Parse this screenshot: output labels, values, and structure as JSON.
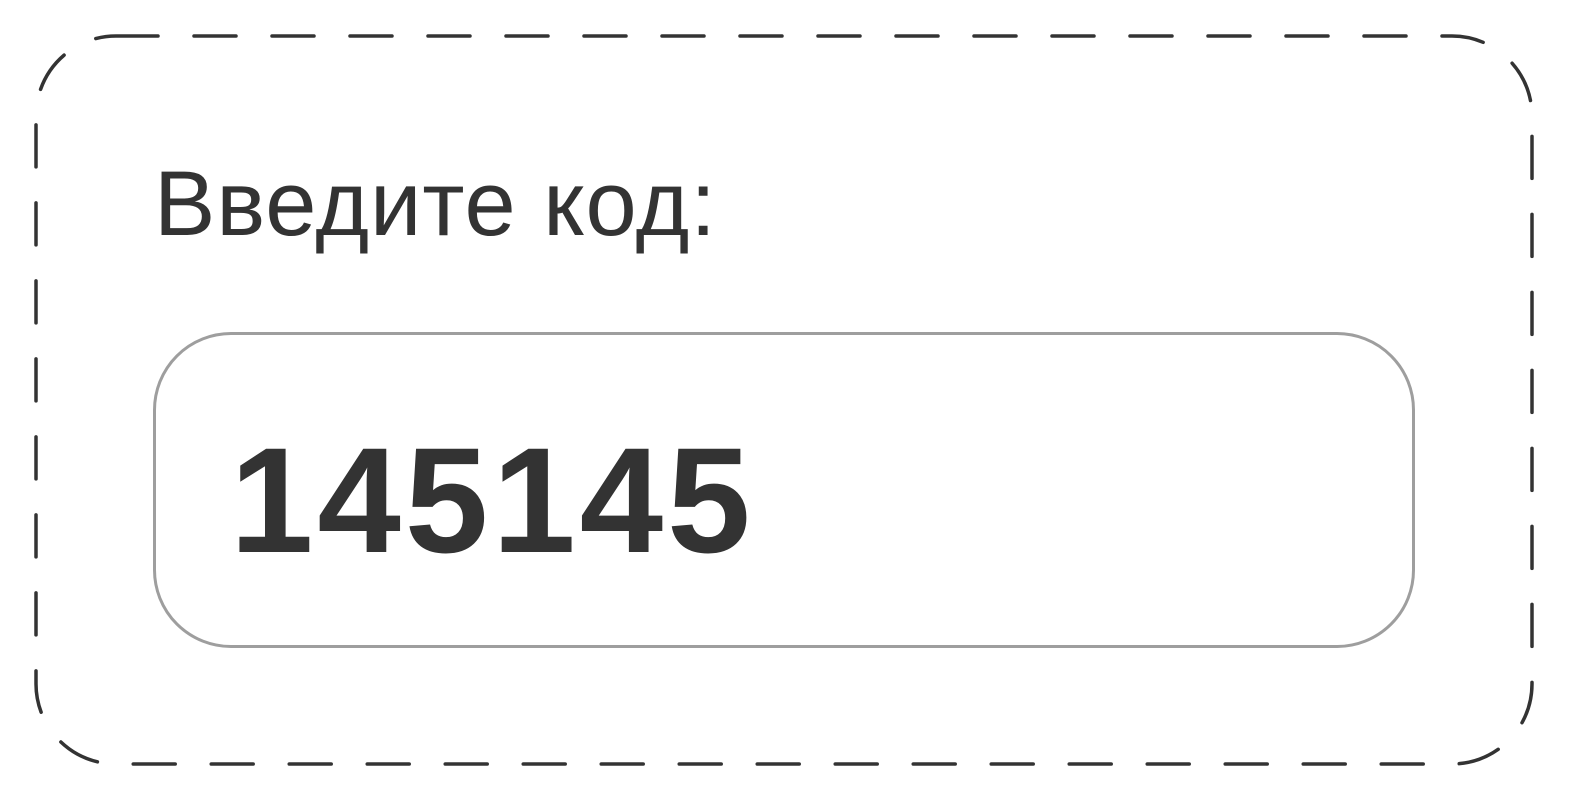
{
  "prompt": {
    "label": "Введите код:"
  },
  "code_field": {
    "value": "145145"
  },
  "colors": {
    "text": "#333333",
    "field_border": "#9e9e9e",
    "frame_dash": "#333333",
    "background": "#ffffff"
  }
}
